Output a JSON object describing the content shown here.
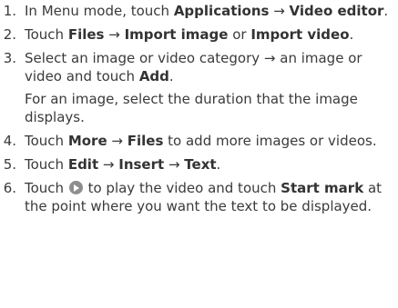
{
  "steps": [
    {
      "num": "1.",
      "parts": [
        "In Menu mode, touch ",
        "Applications",
        " → ",
        "Video editor",
        "."
      ]
    },
    {
      "num": "2.",
      "parts": [
        "Touch ",
        "Files",
        " → ",
        "Import image",
        " or ",
        "Import video",
        "."
      ]
    },
    {
      "num": "3.",
      "parts": [
        "Select an image or video category → an image or video and touch ",
        "Add",
        "."
      ],
      "note": "For an image, select the duration that the image displays."
    },
    {
      "num": "4.",
      "parts": [
        "Touch ",
        "More",
        " → ",
        "Files",
        " to add more images or videos."
      ]
    },
    {
      "num": "5.",
      "parts": [
        "Touch ",
        "Edit",
        " → ",
        "Insert",
        " → ",
        "Text",
        "."
      ]
    },
    {
      "num": "6.",
      "before_icon": "Touch ",
      "icon": "play-icon",
      "parts": [
        " to play the video and touch ",
        "Start mark",
        " at the point where you want the text to be displayed."
      ]
    }
  ]
}
